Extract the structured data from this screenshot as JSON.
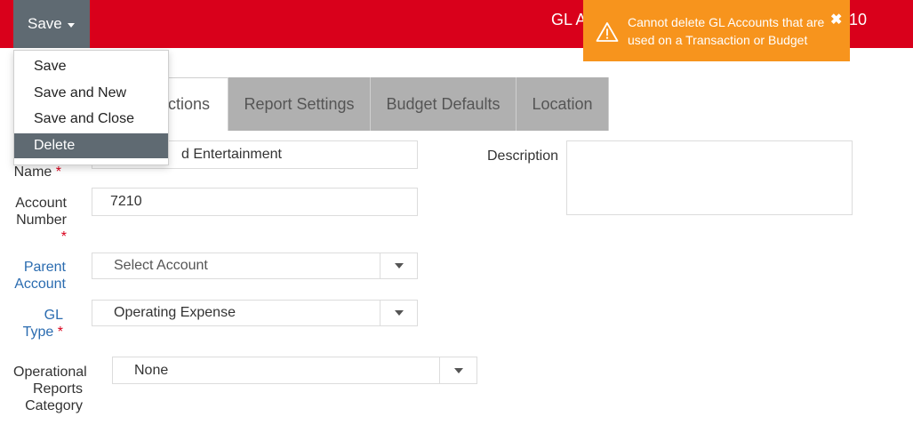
{
  "header": {
    "save_label": "Save",
    "title_left": "GL A",
    "title_right": "10",
    "color": "#d9001b"
  },
  "save_menu": {
    "items": [
      "Save",
      "Save and New",
      "Save and Close",
      "Delete"
    ],
    "active": "Delete"
  },
  "toast": {
    "message": "Cannot delete GL Accounts that are used on a Transaction or Budget",
    "close_symbol": "✖",
    "color": "#f7941d"
  },
  "tabs": [
    {
      "label": "ctions"
    },
    {
      "label": "Report Settings"
    },
    {
      "label": "Budget Defaults"
    },
    {
      "label": "Location"
    }
  ],
  "form": {
    "name": {
      "label": "Name",
      "value": "d Entertainment"
    },
    "account_number": {
      "label_line1": "Account",
      "label_line2": "Number",
      "value": "7210"
    },
    "parent_account": {
      "label_line1": "Parent",
      "label_line2": "Account",
      "placeholder": "Select Account"
    },
    "gl_type": {
      "label_line1": "GL",
      "label_line2": "Type",
      "value": "Operating Expense"
    },
    "operational_reports_category": {
      "label_line1": "Operational",
      "label_line2": "Reports",
      "label_line3": "Category",
      "value": "None"
    },
    "description": {
      "label": "Description",
      "value": ""
    },
    "required_marker": "*"
  }
}
